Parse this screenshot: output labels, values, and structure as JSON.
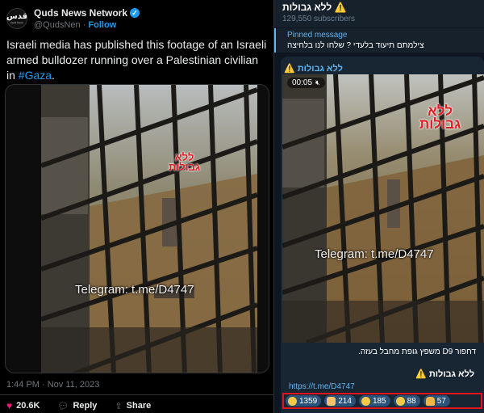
{
  "tweet": {
    "avatar_text": "قدس",
    "avatar_small": "Quds News",
    "name": "Quds News Network",
    "handle": "@QudsNen",
    "dot": "·",
    "follow_label": "Follow",
    "text_main": "Israeli media has published this footage of an Israeli armed bulldozer running over a Palestinian civilian in ",
    "hashtag": "#Gaza",
    "text_end": ".",
    "timestamp": "1:44 PM · Nov 11, 2023",
    "likes": "20.6K",
    "reply_label": "Reply",
    "share_label": "Share",
    "video_watermark": "Telegram: t.me/D4747",
    "video_logo_top": "ללא",
    "video_logo_bottom": "גבולות",
    "colors": {
      "accent": "#1d9bf0",
      "like": "#f91880"
    }
  },
  "telegram": {
    "channel_title": "ללא גבולות ⚠️",
    "subscribers": "129,550 subscribers",
    "pinned_label": "Pinned message",
    "pinned_text": "צילמתם תיעוד בלעדי ? שלחו לנו בלחיצה",
    "post_channel": "ללא גבולות ⚠️",
    "video_time": "00:05",
    "video_watermark": "Telegram: t.me/D4747",
    "video_logo_top": "ללא",
    "video_logo_bottom": "גבולות",
    "caption": "דחפור D9 משפץ גופת מחבל בעזה.",
    "signature": "ללא גבולות ⚠️",
    "link": "https://t.me/D4747",
    "reactions": [
      {
        "emoji": "laughing-emoji",
        "count": "1359"
      },
      {
        "emoji": "clapping-emoji",
        "count": "214"
      },
      {
        "emoji": "heart-eyes-emoji",
        "count": "185"
      },
      {
        "emoji": "party-emoji",
        "count": "88"
      },
      {
        "emoji": "pray-emoji",
        "count": "57"
      }
    ],
    "colors": {
      "background": "#0e1621",
      "link": "#64b5ef",
      "highlight_border": "#e0141e"
    }
  }
}
